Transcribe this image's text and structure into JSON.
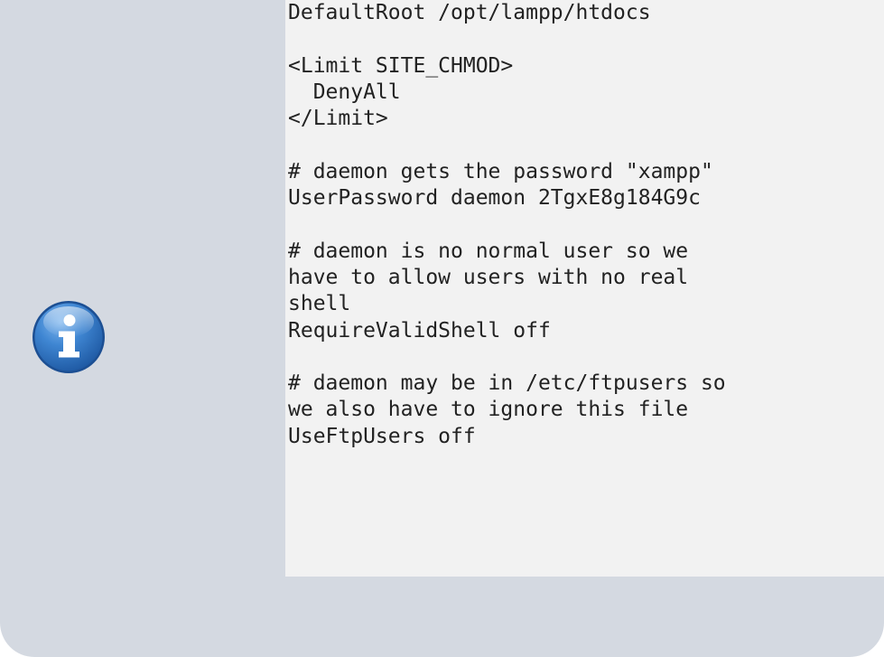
{
  "notice": {
    "icon": "info-icon",
    "colors": {
      "panel_background": "#d4d9e1",
      "code_background": "#f2f2f2",
      "icon_blue": "#2a73c2",
      "text": "#222222"
    },
    "code_lines": [
      "DefaultRoot /opt/lampp/htdocs",
      "",
      "<Limit SITE_CHMOD>",
      "  DenyAll",
      "</Limit>",
      "",
      "# daemon gets the password \"xampp\"",
      "UserPassword daemon 2TgxE8g184G9c",
      "",
      "# daemon is no normal user so we",
      "have to allow users with no real",
      "shell",
      "RequireValidShell off",
      "",
      "# daemon may be in /etc/ftpusers so",
      "we also have to ignore this file",
      "UseFtpUsers off"
    ]
  }
}
